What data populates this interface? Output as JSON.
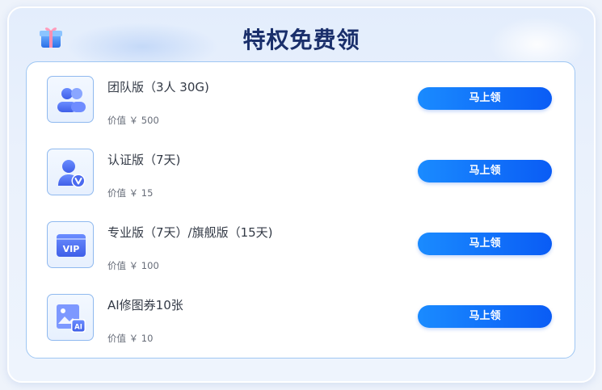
{
  "header": {
    "title": "特权免费领",
    "gift_icon": "gift-icon"
  },
  "colors": {
    "accent": "#0a6cff",
    "title": "#1a2f6b",
    "card_border": "#9fc7f3"
  },
  "items": [
    {
      "name": "团队版（3人 30G)",
      "value": "价值 ￥ 500",
      "button": "马上领",
      "icon": "team-users-icon"
    },
    {
      "name": "认证版（7天)",
      "value": "价值 ￥ 15",
      "button": "马上领",
      "icon": "verified-user-icon"
    },
    {
      "name": "专业版（7天）/旗舰版（15天)",
      "value": "价值 ￥ 100",
      "button": "马上领",
      "icon": "vip-card-icon"
    },
    {
      "name": "AI修图券10张",
      "value": "价值 ￥ 10",
      "button": "马上领",
      "icon": "ai-image-icon"
    }
  ]
}
